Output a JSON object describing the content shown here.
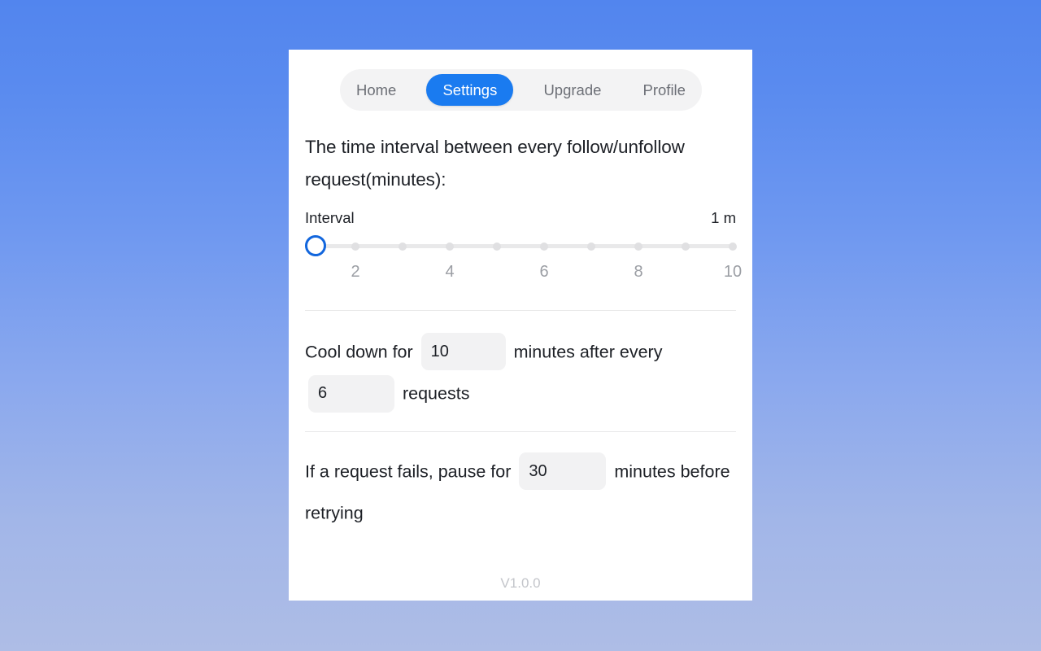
{
  "app": {
    "version_label": "V1.0.0"
  },
  "tabs": [
    {
      "label": "Home",
      "active": false
    },
    {
      "label": "Settings",
      "active": true
    },
    {
      "label": "Upgrade",
      "active": false
    },
    {
      "label": "Profile",
      "active": false
    }
  ],
  "settings": {
    "headline": "The time interval between every follow/unfollow request(minutes):",
    "interval": {
      "label": "Interval",
      "value_label": "1 m",
      "value": 1,
      "min": 1,
      "max": 10,
      "tick_labels": [
        "2",
        "4",
        "6",
        "8",
        "10"
      ]
    },
    "cooldown": {
      "text_before": "Cool down for",
      "minutes_value": "10",
      "text_middle": "minutes after every",
      "requests_value": "6",
      "text_after": "requests"
    },
    "retry": {
      "text_before": "If a request fails, pause for",
      "minutes_value": "30",
      "text_after": "minutes before retrying"
    }
  },
  "colors": {
    "accent": "#1a7bf0",
    "thumb_ring": "#1266dd",
    "field_bg": "#f2f2f3",
    "tabbar_bg": "#f3f3f4",
    "text": "#1d2026",
    "muted": "#9b9ea4"
  }
}
